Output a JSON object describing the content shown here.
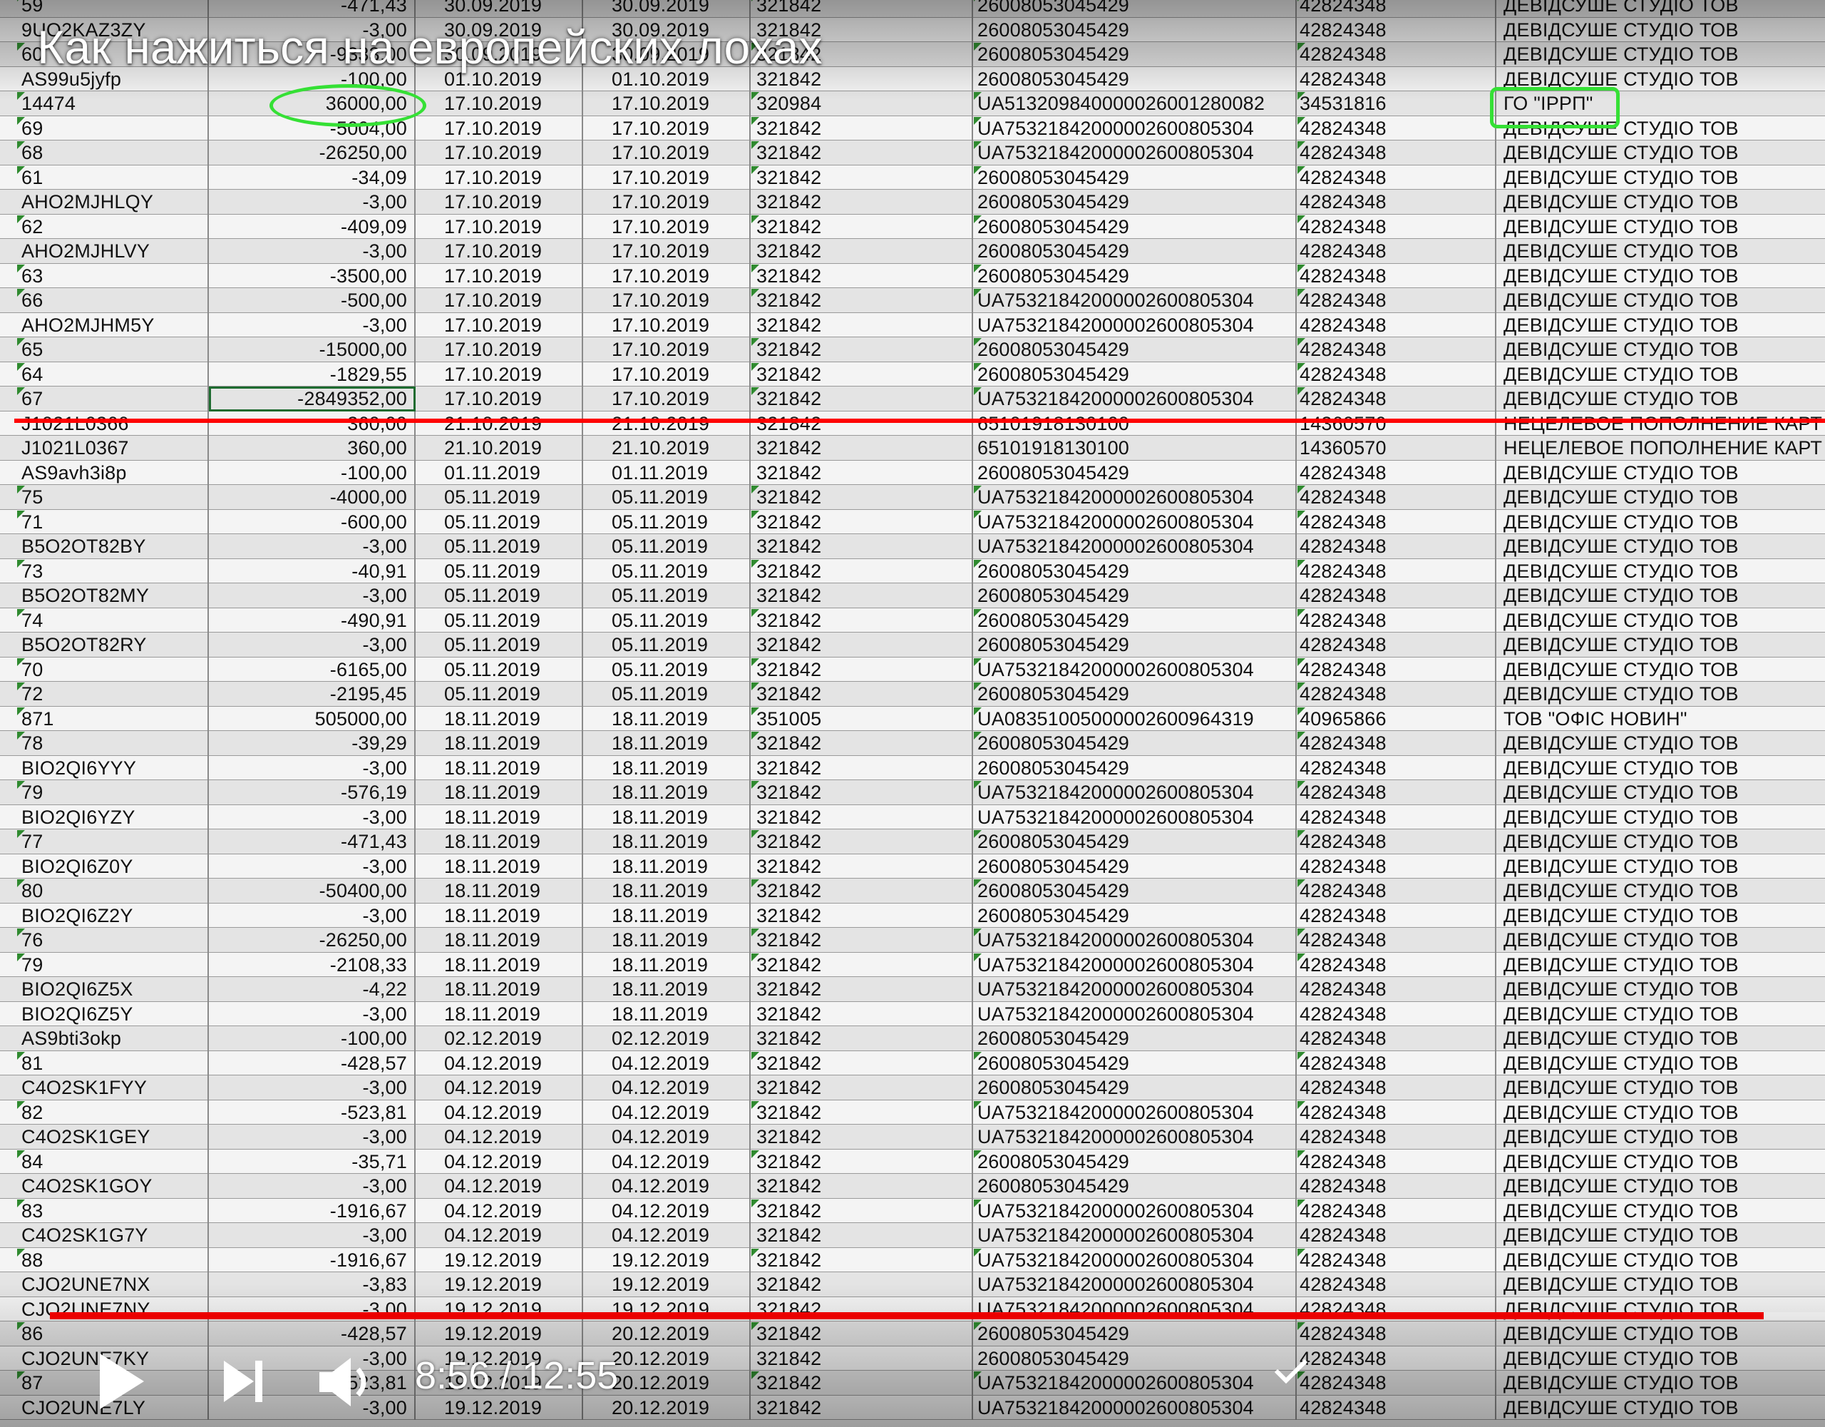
{
  "video": {
    "title": "Как нажиться на европейских лохах",
    "time_current": "8:56",
    "time_separator": " / ",
    "time_total": "12:55",
    "progress_fraction": 0.69
  },
  "colors": {
    "highlight_green": "#35e035",
    "strike_red": "#ff0000",
    "cell_triangle": "#2f8a2f"
  },
  "icons": {
    "play": "play-icon",
    "next": "next-icon",
    "volume": "volume-icon",
    "check": "check-icon"
  },
  "rows": [
    {
      "id": "59",
      "sum": "-471,43",
      "d1": "30.09.2019",
      "d2": "30.09.2019",
      "mfo": "321842",
      "acc": "26008053045429",
      "edr": "42824348",
      "name": "ДЕВІДСУШЕ СТУДІО ТОВ",
      "tri": true
    },
    {
      "id": "9UO2KAZ3ZY",
      "sum": "-3,00",
      "d1": "30.09.2019",
      "d2": "30.09.2019",
      "mfo": "321842",
      "acc": "26008053045429",
      "edr": "42824348",
      "name": "ДЕВІДСУШЕ СТУДІО ТОВ",
      "tri": false
    },
    {
      "id": "60",
      "sum": "-9333,00",
      "d1": "30.09.2019",
      "d2": "30.09.2019",
      "mfo": "321842",
      "acc": "26008053045429",
      "edr": "42824348",
      "name": "ДЕВІДСУШЕ СТУДІО ТОВ",
      "tri": true
    },
    {
      "id": "AS99u5jyfp",
      "sum": "-100,00",
      "d1": "01.10.2019",
      "d2": "01.10.2019",
      "mfo": "321842",
      "acc": "26008053045429",
      "edr": "42824348",
      "name": "ДЕВІДСУШЕ СТУДІО ТОВ",
      "tri": false
    },
    {
      "id": "14474",
      "sum": "36000,00",
      "d1": "17.10.2019",
      "d2": "17.10.2019",
      "mfo": "320984",
      "acc": "UA513209840000026001280082",
      "edr": "34531816",
      "name": "ГО \"ІРРП\"",
      "tri": true
    },
    {
      "id": "69",
      "sum": "-5004,00",
      "d1": "17.10.2019",
      "d2": "17.10.2019",
      "mfo": "321842",
      "acc": "UA75321842000002600805304",
      "edr": "42824348",
      "name": "ДЕВІДСУШЕ СТУДІО ТОВ",
      "tri": true
    },
    {
      "id": "68",
      "sum": "-26250,00",
      "d1": "17.10.2019",
      "d2": "17.10.2019",
      "mfo": "321842",
      "acc": "UA75321842000002600805304",
      "edr": "42824348",
      "name": "ДЕВІДСУШЕ СТУДІО ТОВ",
      "tri": true
    },
    {
      "id": "61",
      "sum": "-34,09",
      "d1": "17.10.2019",
      "d2": "17.10.2019",
      "mfo": "321842",
      "acc": "26008053045429",
      "edr": "42824348",
      "name": "ДЕВІДСУШЕ СТУДІО ТОВ",
      "tri": true
    },
    {
      "id": "AHO2MJHLQY",
      "sum": "-3,00",
      "d1": "17.10.2019",
      "d2": "17.10.2019",
      "mfo": "321842",
      "acc": "26008053045429",
      "edr": "42824348",
      "name": "ДЕВІДСУШЕ СТУДІО ТОВ",
      "tri": false
    },
    {
      "id": "62",
      "sum": "-409,09",
      "d1": "17.10.2019",
      "d2": "17.10.2019",
      "mfo": "321842",
      "acc": "26008053045429",
      "edr": "42824348",
      "name": "ДЕВІДСУШЕ СТУДІО ТОВ",
      "tri": true
    },
    {
      "id": "AHO2MJHLVY",
      "sum": "-3,00",
      "d1": "17.10.2019",
      "d2": "17.10.2019",
      "mfo": "321842",
      "acc": "26008053045429",
      "edr": "42824348",
      "name": "ДЕВІДСУШЕ СТУДІО ТОВ",
      "tri": false
    },
    {
      "id": "63",
      "sum": "-3500,00",
      "d1": "17.10.2019",
      "d2": "17.10.2019",
      "mfo": "321842",
      "acc": "26008053045429",
      "edr": "42824348",
      "name": "ДЕВІДСУШЕ СТУДІО ТОВ",
      "tri": true
    },
    {
      "id": "66",
      "sum": "-500,00",
      "d1": "17.10.2019",
      "d2": "17.10.2019",
      "mfo": "321842",
      "acc": "UA75321842000002600805304",
      "edr": "42824348",
      "name": "ДЕВІДСУШЕ СТУДІО ТОВ",
      "tri": true
    },
    {
      "id": "AHO2MJHM5Y",
      "sum": "-3,00",
      "d1": "17.10.2019",
      "d2": "17.10.2019",
      "mfo": "321842",
      "acc": "UA75321842000002600805304",
      "edr": "42824348",
      "name": "ДЕВІДСУШЕ СТУДІО ТОВ",
      "tri": false
    },
    {
      "id": "65",
      "sum": "-15000,00",
      "d1": "17.10.2019",
      "d2": "17.10.2019",
      "mfo": "321842",
      "acc": "26008053045429",
      "edr": "42824348",
      "name": "ДЕВІДСУШЕ СТУДІО ТОВ",
      "tri": true
    },
    {
      "id": "64",
      "sum": "-1829,55",
      "d1": "17.10.2019",
      "d2": "17.10.2019",
      "mfo": "321842",
      "acc": "26008053045429",
      "edr": "42824348",
      "name": "ДЕВІДСУШЕ СТУДІО ТОВ",
      "tri": true
    },
    {
      "id": "67",
      "sum": "-2849352,00",
      "d1": "17.10.2019",
      "d2": "17.10.2019",
      "mfo": "321842",
      "acc": "UA75321842000002600805304",
      "edr": "42824348",
      "name": "ДЕВІДСУШЕ СТУДІО ТОВ",
      "tri": true,
      "selected": true
    },
    {
      "id": "J1021L0366",
      "sum": "360,00",
      "d1": "21.10.2019",
      "d2": "21.10.2019",
      "mfo": "321842",
      "acc": "65101918130100",
      "edr": "14360570",
      "name": "НЕЦЕЛЕВОЕ ПОПОЛНЕНИЕ КАРТ",
      "tri": false
    },
    {
      "id": "J1021L0367",
      "sum": "360,00",
      "d1": "21.10.2019",
      "d2": "21.10.2019",
      "mfo": "321842",
      "acc": "65101918130100",
      "edr": "14360570",
      "name": "НЕЦЕЛЕВОЕ ПОПОЛНЕНИЕ КАРТ",
      "tri": false
    },
    {
      "id": "AS9avh3i8p",
      "sum": "-100,00",
      "d1": "01.11.2019",
      "d2": "01.11.2019",
      "mfo": "321842",
      "acc": "26008053045429",
      "edr": "42824348",
      "name": "ДЕВІДСУШЕ СТУДІО ТОВ",
      "tri": false
    },
    {
      "id": "75",
      "sum": "-4000,00",
      "d1": "05.11.2019",
      "d2": "05.11.2019",
      "mfo": "321842",
      "acc": "UA75321842000002600805304",
      "edr": "42824348",
      "name": "ДЕВІДСУШЕ СТУДІО ТОВ",
      "tri": true
    },
    {
      "id": "71",
      "sum": "-600,00",
      "d1": "05.11.2019",
      "d2": "05.11.2019",
      "mfo": "321842",
      "acc": "UA75321842000002600805304",
      "edr": "42824348",
      "name": "ДЕВІДСУШЕ СТУДІО ТОВ",
      "tri": true
    },
    {
      "id": "B5O2OT82BY",
      "sum": "-3,00",
      "d1": "05.11.2019",
      "d2": "05.11.2019",
      "mfo": "321842",
      "acc": "UA75321842000002600805304",
      "edr": "42824348",
      "name": "ДЕВІДСУШЕ СТУДІО ТОВ",
      "tri": false
    },
    {
      "id": "73",
      "sum": "-40,91",
      "d1": "05.11.2019",
      "d2": "05.11.2019",
      "mfo": "321842",
      "acc": "26008053045429",
      "edr": "42824348",
      "name": "ДЕВІДСУШЕ СТУДІО ТОВ",
      "tri": true
    },
    {
      "id": "B5O2OT82MY",
      "sum": "-3,00",
      "d1": "05.11.2019",
      "d2": "05.11.2019",
      "mfo": "321842",
      "acc": "26008053045429",
      "edr": "42824348",
      "name": "ДЕВІДСУШЕ СТУДІО ТОВ",
      "tri": false
    },
    {
      "id": "74",
      "sum": "-490,91",
      "d1": "05.11.2019",
      "d2": "05.11.2019",
      "mfo": "321842",
      "acc": "26008053045429",
      "edr": "42824348",
      "name": "ДЕВІДСУШЕ СТУДІО ТОВ",
      "tri": true
    },
    {
      "id": "B5O2OT82RY",
      "sum": "-3,00",
      "d1": "05.11.2019",
      "d2": "05.11.2019",
      "mfo": "321842",
      "acc": "26008053045429",
      "edr": "42824348",
      "name": "ДЕВІДСУШЕ СТУДІО ТОВ",
      "tri": false
    },
    {
      "id": "70",
      "sum": "-6165,00",
      "d1": "05.11.2019",
      "d2": "05.11.2019",
      "mfo": "321842",
      "acc": "UA75321842000002600805304",
      "edr": "42824348",
      "name": "ДЕВІДСУШЕ СТУДІО ТОВ",
      "tri": true
    },
    {
      "id": "72",
      "sum": "-2195,45",
      "d1": "05.11.2019",
      "d2": "05.11.2019",
      "mfo": "321842",
      "acc": "26008053045429",
      "edr": "42824348",
      "name": "ДЕВІДСУШЕ СТУДІО ТОВ",
      "tri": true
    },
    {
      "id": "871",
      "sum": "505000,00",
      "d1": "18.11.2019",
      "d2": "18.11.2019",
      "mfo": "351005",
      "acc": "UA08351005000002600964319",
      "edr": "40965866",
      "name": "ТОВ \"ОФІС НОВИН\"",
      "tri": true
    },
    {
      "id": "78",
      "sum": "-39,29",
      "d1": "18.11.2019",
      "d2": "18.11.2019",
      "mfo": "321842",
      "acc": "26008053045429",
      "edr": "42824348",
      "name": "ДЕВІДСУШЕ СТУДІО ТОВ",
      "tri": true
    },
    {
      "id": "BIO2QI6YYY",
      "sum": "-3,00",
      "d1": "18.11.2019",
      "d2": "18.11.2019",
      "mfo": "321842",
      "acc": "26008053045429",
      "edr": "42824348",
      "name": "ДЕВІДСУШЕ СТУДІО ТОВ",
      "tri": false
    },
    {
      "id": "79",
      "sum": "-576,19",
      "d1": "18.11.2019",
      "d2": "18.11.2019",
      "mfo": "321842",
      "acc": "UA75321842000002600805304",
      "edr": "42824348",
      "name": "ДЕВІДСУШЕ СТУДІО ТОВ",
      "tri": true
    },
    {
      "id": "BIO2QI6YZY",
      "sum": "-3,00",
      "d1": "18.11.2019",
      "d2": "18.11.2019",
      "mfo": "321842",
      "acc": "UA75321842000002600805304",
      "edr": "42824348",
      "name": "ДЕВІДСУШЕ СТУДІО ТОВ",
      "tri": false
    },
    {
      "id": "77",
      "sum": "-471,43",
      "d1": "18.11.2019",
      "d2": "18.11.2019",
      "mfo": "321842",
      "acc": "26008053045429",
      "edr": "42824348",
      "name": "ДЕВІДСУШЕ СТУДІО ТОВ",
      "tri": true
    },
    {
      "id": "BIO2QI6Z0Y",
      "sum": "-3,00",
      "d1": "18.11.2019",
      "d2": "18.11.2019",
      "mfo": "321842",
      "acc": "26008053045429",
      "edr": "42824348",
      "name": "ДЕВІДСУШЕ СТУДІО ТОВ",
      "tri": false
    },
    {
      "id": "80",
      "sum": "-50400,00",
      "d1": "18.11.2019",
      "d2": "18.11.2019",
      "mfo": "321842",
      "acc": "26008053045429",
      "edr": "42824348",
      "name": "ДЕВІДСУШЕ СТУДІО ТОВ",
      "tri": true
    },
    {
      "id": "BIO2QI6Z2Y",
      "sum": "-3,00",
      "d1": "18.11.2019",
      "d2": "18.11.2019",
      "mfo": "321842",
      "acc": "26008053045429",
      "edr": "42824348",
      "name": "ДЕВІДСУШЕ СТУДІО ТОВ",
      "tri": false
    },
    {
      "id": "76",
      "sum": "-26250,00",
      "d1": "18.11.2019",
      "d2": "18.11.2019",
      "mfo": "321842",
      "acc": "UA75321842000002600805304",
      "edr": "42824348",
      "name": "ДЕВІДСУШЕ СТУДІО ТОВ",
      "tri": true
    },
    {
      "id": "79",
      "sum": "-2108,33",
      "d1": "18.11.2019",
      "d2": "18.11.2019",
      "mfo": "321842",
      "acc": "UA75321842000002600805304",
      "edr": "42824348",
      "name": "ДЕВІДСУШЕ СТУДІО ТОВ",
      "tri": true
    },
    {
      "id": "BIO2QI6Z5X",
      "sum": "-4,22",
      "d1": "18.11.2019",
      "d2": "18.11.2019",
      "mfo": "321842",
      "acc": "UA75321842000002600805304",
      "edr": "42824348",
      "name": "ДЕВІДСУШЕ СТУДІО ТОВ",
      "tri": false
    },
    {
      "id": "BIO2QI6Z5Y",
      "sum": "-3,00",
      "d1": "18.11.2019",
      "d2": "18.11.2019",
      "mfo": "321842",
      "acc": "UA75321842000002600805304",
      "edr": "42824348",
      "name": "ДЕВІДСУШЕ СТУДІО ТОВ",
      "tri": false
    },
    {
      "id": "AS9bti3okp",
      "sum": "-100,00",
      "d1": "02.12.2019",
      "d2": "02.12.2019",
      "mfo": "321842",
      "acc": "26008053045429",
      "edr": "42824348",
      "name": "ДЕВІДСУШЕ СТУДІО ТОВ",
      "tri": false
    },
    {
      "id": "81",
      "sum": "-428,57",
      "d1": "04.12.2019",
      "d2": "04.12.2019",
      "mfo": "321842",
      "acc": "26008053045429",
      "edr": "42824348",
      "name": "ДЕВІДСУШЕ СТУДІО ТОВ",
      "tri": true
    },
    {
      "id": "C4O2SK1FYY",
      "sum": "-3,00",
      "d1": "04.12.2019",
      "d2": "04.12.2019",
      "mfo": "321842",
      "acc": "26008053045429",
      "edr": "42824348",
      "name": "ДЕВІДСУШЕ СТУДІО ТОВ",
      "tri": false
    },
    {
      "id": "82",
      "sum": "-523,81",
      "d1": "04.12.2019",
      "d2": "04.12.2019",
      "mfo": "321842",
      "acc": "UA75321842000002600805304",
      "edr": "42824348",
      "name": "ДЕВІДСУШЕ СТУДІО ТОВ",
      "tri": true
    },
    {
      "id": "C4O2SK1GEY",
      "sum": "-3,00",
      "d1": "04.12.2019",
      "d2": "04.12.2019",
      "mfo": "321842",
      "acc": "UA75321842000002600805304",
      "edr": "42824348",
      "name": "ДЕВІДСУШЕ СТУДІО ТОВ",
      "tri": false
    },
    {
      "id": "84",
      "sum": "-35,71",
      "d1": "04.12.2019",
      "d2": "04.12.2019",
      "mfo": "321842",
      "acc": "26008053045429",
      "edr": "42824348",
      "name": "ДЕВІДСУШЕ СТУДІО ТОВ",
      "tri": true
    },
    {
      "id": "C4O2SK1GOY",
      "sum": "-3,00",
      "d1": "04.12.2019",
      "d2": "04.12.2019",
      "mfo": "321842",
      "acc": "26008053045429",
      "edr": "42824348",
      "name": "ДЕВІДСУШЕ СТУДІО ТОВ",
      "tri": false
    },
    {
      "id": "83",
      "sum": "-1916,67",
      "d1": "04.12.2019",
      "d2": "04.12.2019",
      "mfo": "321842",
      "acc": "UA75321842000002600805304",
      "edr": "42824348",
      "name": "ДЕВІДСУШЕ СТУДІО ТОВ",
      "tri": true
    },
    {
      "id": "C4O2SK1G7Y",
      "sum": "-3,00",
      "d1": "04.12.2019",
      "d2": "04.12.2019",
      "mfo": "321842",
      "acc": "UA75321842000002600805304",
      "edr": "42824348",
      "name": "ДЕВІДСУШЕ СТУДІО ТОВ",
      "tri": false
    },
    {
      "id": "88",
      "sum": "-1916,67",
      "d1": "19.12.2019",
      "d2": "19.12.2019",
      "mfo": "321842",
      "acc": "UA75321842000002600805304",
      "edr": "42824348",
      "name": "ДЕВІДСУШЕ СТУДІО ТОВ",
      "tri": true
    },
    {
      "id": "CJO2UNE7NX",
      "sum": "-3,83",
      "d1": "19.12.2019",
      "d2": "19.12.2019",
      "mfo": "321842",
      "acc": "UA75321842000002600805304",
      "edr": "42824348",
      "name": "ДЕВІДСУШЕ СТУДІО ТОВ",
      "tri": false
    },
    {
      "id": "CJO2UNE7NY",
      "sum": "-3,00",
      "d1": "19.12.2019",
      "d2": "19.12.2019",
      "mfo": "321842",
      "acc": "UA75321842000002600805304",
      "edr": "42824348",
      "name": "ДЕВІДСУШЕ СТУДІО ТОВ",
      "tri": false
    },
    {
      "id": "86",
      "sum": "-428,57",
      "d1": "19.12.2019",
      "d2": "20.12.2019",
      "mfo": "321842",
      "acc": "26008053045429",
      "edr": "42824348",
      "name": "ДЕВІДСУШЕ СТУДІО ТОВ",
      "tri": true
    },
    {
      "id": "CJO2UNE7KY",
      "sum": "-3,00",
      "d1": "19.12.2019",
      "d2": "20.12.2019",
      "mfo": "321842",
      "acc": "26008053045429",
      "edr": "42824348",
      "name": "ДЕВІДСУШЕ СТУДІО ТОВ",
      "tri": false
    },
    {
      "id": "87",
      "sum": "-523,81",
      "d1": "19.12.2019",
      "d2": "20.12.2019",
      "mfo": "321842",
      "acc": "UA75321842000002600805304",
      "edr": "42824348",
      "name": "ДЕВІДСУШЕ СТУДІО ТОВ",
      "tri": true
    },
    {
      "id": "CJO2UNE7LY",
      "sum": "-3,00",
      "d1": "19.12.2019",
      "d2": "20.12.2019",
      "mfo": "321842",
      "acc": "UA75321842000002600805304",
      "edr": "42824348",
      "name": "ДЕВІДСУШЕ СТУДІО ТОВ",
      "tri": false
    }
  ]
}
